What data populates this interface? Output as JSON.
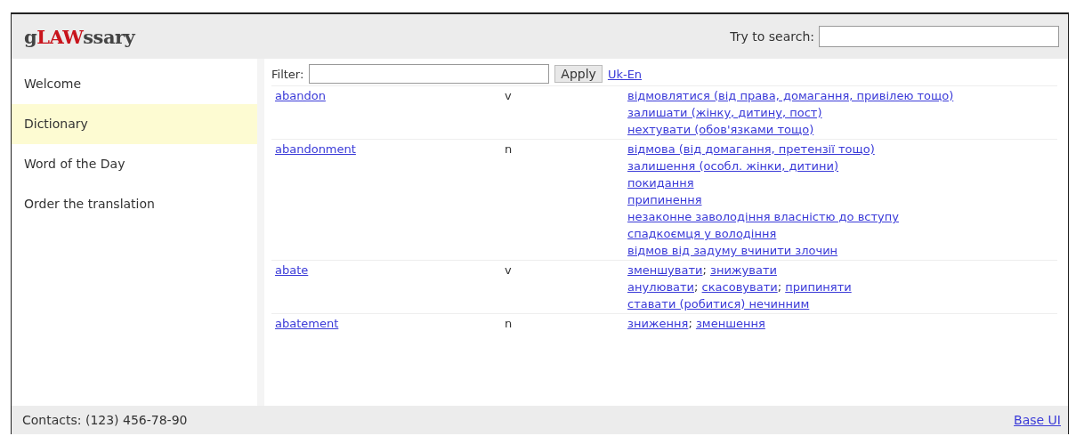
{
  "header": {
    "logo": {
      "prefix": "g",
      "highlight": "LAW",
      "suffix": "ssary"
    },
    "search": {
      "label": "Try to search:"
    }
  },
  "sidebar": {
    "items": [
      {
        "label": "Welcome",
        "selected": false
      },
      {
        "label": "Dictionary",
        "selected": true
      },
      {
        "label": "Word of the Day",
        "selected": false
      },
      {
        "label": "Order the translation",
        "selected": false
      }
    ]
  },
  "filter": {
    "label": "Filter:",
    "button": "Apply",
    "direction_link": "Uk-En"
  },
  "entries": [
    {
      "word": "abandon",
      "pos": "v",
      "translations": [
        [
          "відмовлятися (від права, домагання, привілею тощо)"
        ],
        [
          "залишати (жінку, дитину, пост)"
        ],
        [
          "нехтувати (обов'язками тощо)"
        ]
      ]
    },
    {
      "word": "abandonment",
      "pos": "n",
      "translations": [
        [
          "відмова (від домагання, претензії тощо)"
        ],
        [
          "залишення (особл. жінки, дитини)"
        ],
        [
          "покидання"
        ],
        [
          "припинення"
        ],
        [
          "незаконне заволодіння власністю до вступу"
        ],
        [
          "спадкоємця у володіння"
        ],
        [
          "відмов від задуму вчинити злочин"
        ]
      ]
    },
    {
      "word": "abate",
      "pos": "v",
      "translations": [
        [
          "зменшувати",
          ";",
          "знижувати"
        ],
        [
          "анулювати",
          ";",
          "скасовувати",
          ";",
          "припиняти"
        ],
        [
          "ставати (робитися) нечинним"
        ]
      ]
    },
    {
      "word": "abatement",
      "pos": "n",
      "translations": [
        [
          "зниження",
          ";",
          "зменшення"
        ]
      ]
    }
  ],
  "footer": {
    "contacts": "Contacts: (123) 456-78-90",
    "link": "Base UI"
  }
}
